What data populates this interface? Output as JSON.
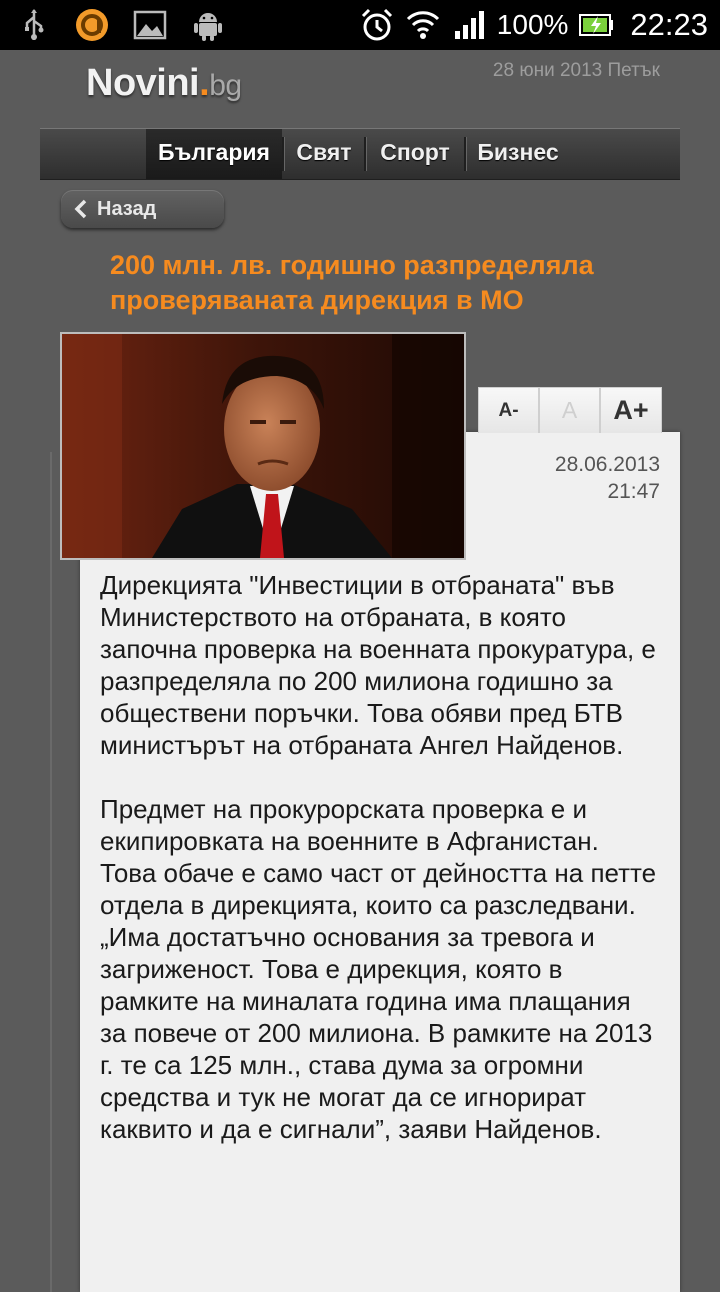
{
  "status_bar": {
    "battery": "100%",
    "time": "22:23",
    "icons": [
      "usb-icon",
      "app-icon",
      "gallery-icon",
      "android-icon",
      "alarm-icon",
      "wifi-icon",
      "signal-icon",
      "battery-icon"
    ]
  },
  "header": {
    "logo_main": "Novini",
    "logo_dot": ".",
    "logo_tld": "bg",
    "date": "28 юни 2013 Петък"
  },
  "nav": {
    "tabs": [
      {
        "label": "България",
        "active": true
      },
      {
        "label": "Свят",
        "active": false
      },
      {
        "label": "Спорт",
        "active": false
      },
      {
        "label": "Бизнес",
        "active": false
      }
    ]
  },
  "back": {
    "label": "Назад"
  },
  "article": {
    "title": "200 млн. лв. годишно разпределяла проверяваната дирекция в МО",
    "date": "28.06.2013",
    "time": "21:47",
    "paragraphs": [
      "Дирекцията \"Инвестиции в отбраната\" във Министерството на отбраната, в която започна проверка на военната прокуратура, е разпределяла по 200 милиона годишно за обществени поръчки. Това обяви пред БТВ министърът на отбраната Ангел Найденов.",
      "Предмет на прокурорската проверка е и екипировката на военните в Афганистан. Това обаче е само част от дейността на петте отдела в дирекцията, които са разследвани. „Има достатъчно основания за тревога и загриженост. Това е дирекция, която в рамките на миналата година има плащания за повече от 200 милиона. В рамките на 2013 г. те са 125 млн., става дума за огромни средства и тук не могат да се игнорират каквито и да е сигнали”, заяви Найденов."
    ]
  },
  "font_controls": {
    "decrease": "A-",
    "normal": "A",
    "increase": "A+"
  },
  "colors": {
    "accent": "#f68b1f",
    "background": "#5b5b5b",
    "panel": "#f0f0f0"
  }
}
